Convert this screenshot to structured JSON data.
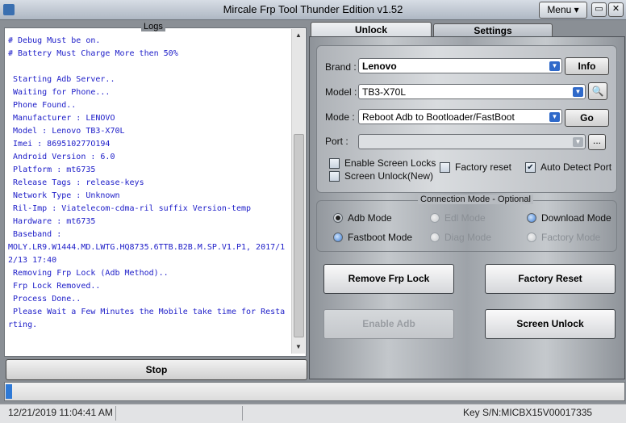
{
  "window": {
    "title": "Mircale Frp Tool Thunder Edition v1.52",
    "menu_label": "Menu ▾",
    "minimize": "▭",
    "maximize": "▭",
    "close": "✕"
  },
  "logs": {
    "label": "Logs",
    "lines": [
      "# Debug Must be on.",
      "# Battery Must Charge More then 50%",
      "",
      " Starting Adb Server..",
      " Waiting for Phone...",
      " Phone Found..",
      " Manufacturer : LENOVO",
      " Model : Lenovo TB3-X70L",
      " Imei : 869510277O194",
      " Android Version : 6.0",
      " Platform : mt6735",
      " Release Tags : release-keys",
      " Network Type : Unknown",
      " Ril-Imp : Viatelecom-cdma-ril suffix Version-temp",
      " Hardware : mt6735",
      " Baseband :",
      "MOLY.LR9.W1444.MD.LWTG.HQ8735.6TTB.B2B.M.SP.V1.P1, 2017/12/13 17:40",
      " Removing Frp Lock (Adb Method)..",
      " Frp Lock Removed..",
      " Process Done..",
      " Please Wait a Few Minutes the Mobile take time for Restarting."
    ],
    "stop_label": "Stop"
  },
  "tabs": {
    "unlock": "Unlock",
    "settings": "Settings"
  },
  "device": {
    "brand_label": "Brand :",
    "brand_value": "Lenovo",
    "info_label": "Info",
    "model_label": "Model :",
    "model_value": "TB3-X70L",
    "mode_label": "Mode :",
    "mode_value": "Reboot Adb to Bootloader/FastBoot",
    "go_label": "Go",
    "port_label": "Port :",
    "port_value": "",
    "port_browse": "..."
  },
  "options": {
    "enable_screen_locks": "Enable Screen Locks",
    "screen_unlock_new": "Screen Unlock(New)",
    "factory_reset": "Factory reset",
    "auto_detect_port": "Auto Detect Port"
  },
  "connection": {
    "label": "Connection Mode - Optional",
    "adb": "Adb Mode",
    "edl": "Edl Mode",
    "download": "Download Mode",
    "fastboot": "Fastboot Mode",
    "diag": "Diag Mode",
    "factory": "Factory Mode"
  },
  "actions": {
    "remove_frp": "Remove Frp Lock",
    "factory_reset": "Factory Reset",
    "enable_adb": "Enable Adb",
    "screen_unlock": "Screen Unlock"
  },
  "progress": {
    "value": 0.01
  },
  "status": {
    "datetime": "12/21/2019 11:04:41 AM",
    "key": "Key S/N:MICBX15V00017335"
  },
  "colors": {
    "log_text": "#1c1cc8",
    "accent": "#2f69c9"
  }
}
